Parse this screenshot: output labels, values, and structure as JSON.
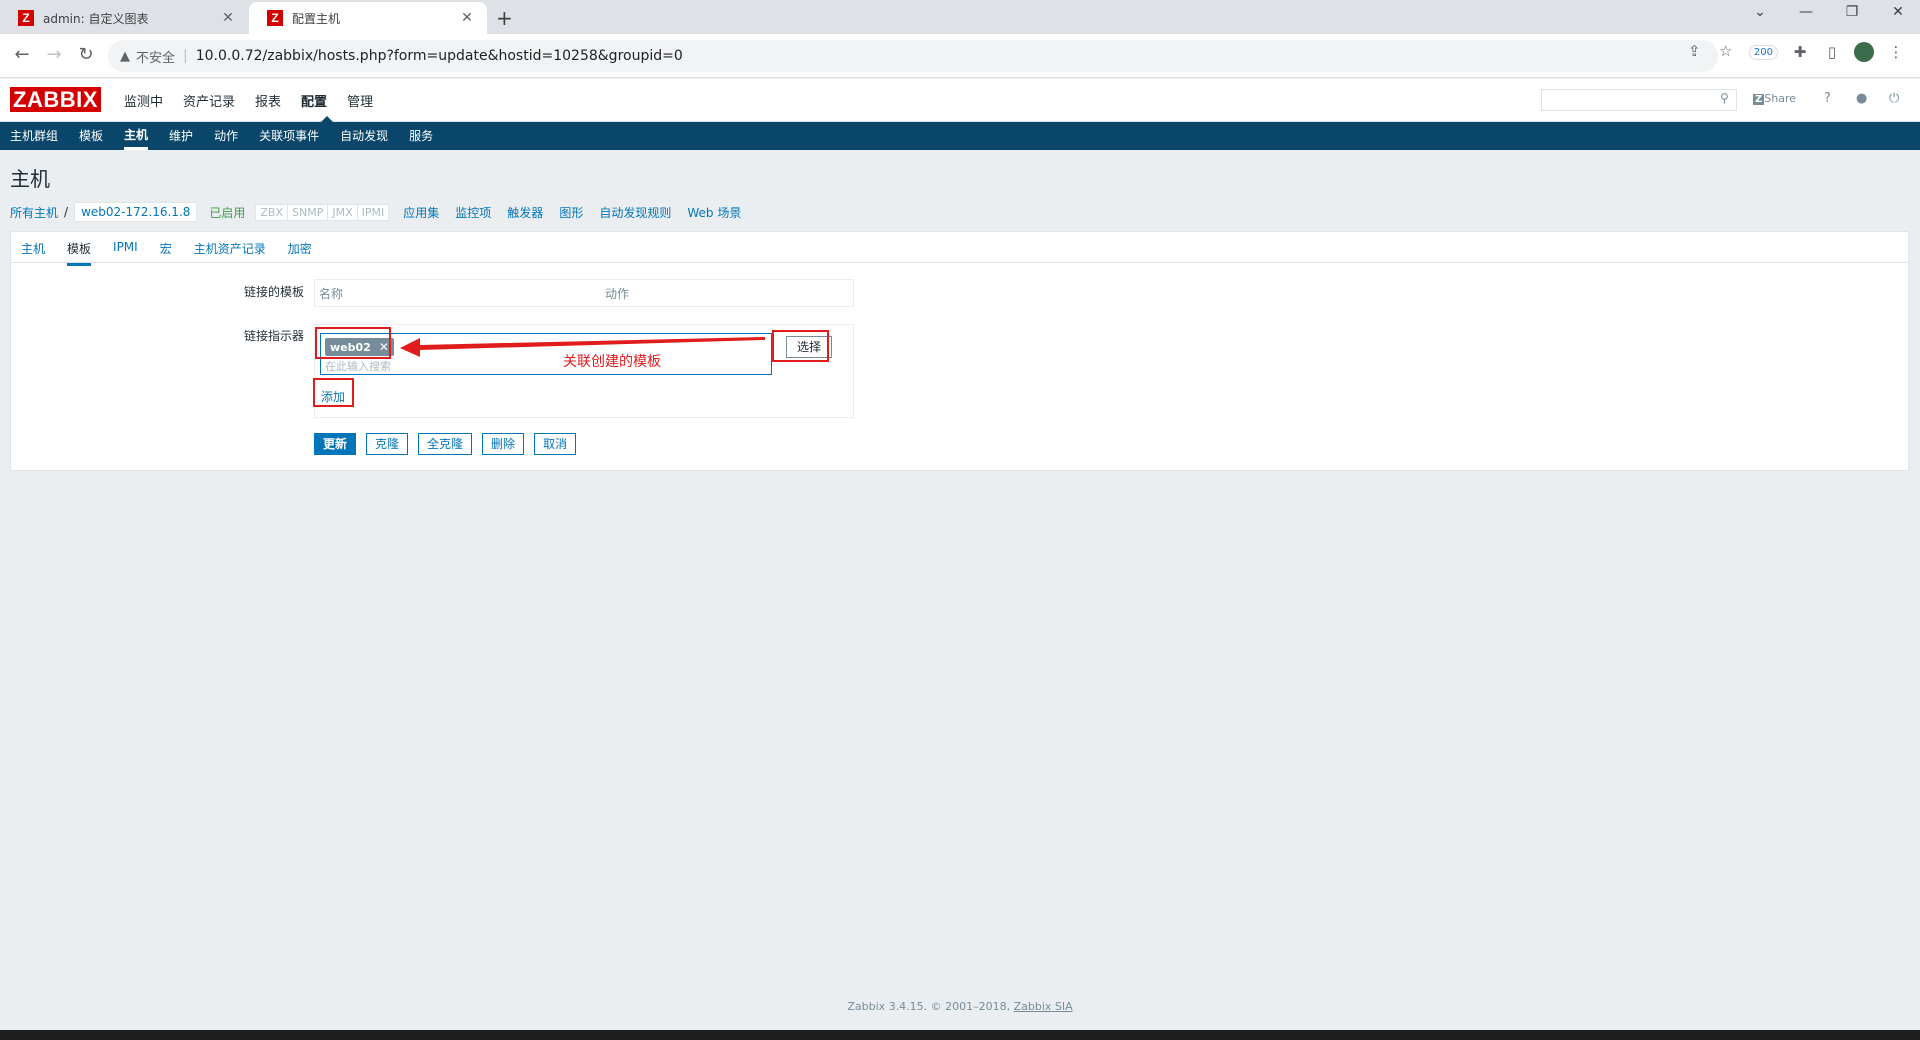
{
  "browser": {
    "tabs": [
      {
        "title": "admin: 自定义图表",
        "active": false
      },
      {
        "title": "配置主机",
        "active": true
      }
    ],
    "new_tab": "+",
    "not_secure": "不安全",
    "url": "10.0.0.72/zabbix/hosts.php?form=update&hostid=10258&groupid=0",
    "ext_badge": "200"
  },
  "zabbix": {
    "logo": "ZABBIX",
    "main_menu": [
      "监测中",
      "资产记录",
      "报表",
      "配置",
      "管理"
    ],
    "main_menu_selected": "配置",
    "share_label": "Share",
    "help_label": "?",
    "sub_menu": [
      "主机群组",
      "模板",
      "主机",
      "维护",
      "动作",
      "关联项事件",
      "自动发现",
      "服务"
    ],
    "sub_menu_selected": "主机",
    "page_title": "主机",
    "host_bar": {
      "all_hosts": "所有主机",
      "separator": "/",
      "current_host": "web02-172.16.1.8",
      "status": "已启用",
      "availability": [
        "ZBX",
        "SNMP",
        "JMX",
        "IPMI"
      ],
      "links": [
        "应用集",
        "监控项",
        "触发器",
        "图形",
        "自动发现规则",
        "Web 场景"
      ]
    },
    "form_tabs": [
      "主机",
      "模板",
      "IPMI",
      "宏",
      "主机资产记录",
      "加密"
    ],
    "form_tab_selected": "模板",
    "linked_templates_label": "链接的模板",
    "linked_templates_cols": [
      "名称",
      "动作"
    ],
    "link_indicator_label": "链接指示器",
    "selected_template": "web02",
    "chip_remove": "✕",
    "search_placeholder": "在此输入搜索",
    "select_button": "选择",
    "add_link": "添加",
    "buttons": [
      "更新",
      "克隆",
      "全克隆",
      "删除",
      "取消"
    ],
    "footer_text": "Zabbix 3.4.15. © 2001–2018,",
    "footer_link": "Zabbix SIA"
  },
  "annotation": {
    "text": "关联创建的模板",
    "color": "#e11c1c"
  },
  "colors": {
    "brand_red": "#d40000",
    "subnav_blue": "#0a466a",
    "link_blue": "#0275b8",
    "enabled_green": "#429e47"
  }
}
